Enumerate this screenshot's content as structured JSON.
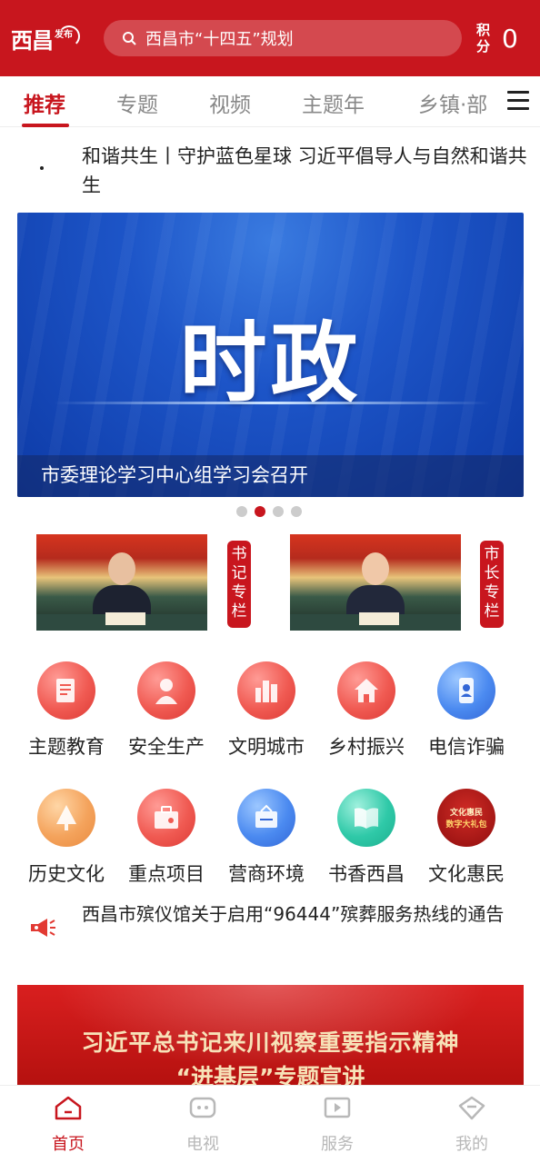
{
  "header": {
    "logo_main": "西昌",
    "logo_sub": "发布",
    "search_placeholder": "西昌市“十四五”规划",
    "points_label": "积分",
    "points_value": "0"
  },
  "tabs": [
    "推荐",
    "专题",
    "视频",
    "主题年",
    "乡镇·部"
  ],
  "active_tab": "推荐",
  "headline": "和谐共生丨守护蓝色星球  习近平倡导人与自然和谐共生",
  "banner": {
    "title": "时政",
    "caption": "市委理论学习中心组学习会召开",
    "slide_count": 4,
    "active_slide": 2
  },
  "leaders": [
    {
      "label": "书记专栏"
    },
    {
      "label": "市长专栏"
    }
  ],
  "shortcuts": [
    {
      "label": "主题教育",
      "icon": "document-icon"
    },
    {
      "label": "安全生产",
      "icon": "worker-icon"
    },
    {
      "label": "文明城市",
      "icon": "city-icon"
    },
    {
      "label": "乡村振兴",
      "icon": "house-icon"
    },
    {
      "label": "电信诈骗",
      "icon": "phone-icon"
    },
    {
      "label": "历史文化",
      "icon": "tree-icon"
    },
    {
      "label": "重点项目",
      "icon": "briefcase-icon"
    },
    {
      "label": "营商环境",
      "icon": "sign-icon"
    },
    {
      "label": "书香西昌",
      "icon": "book-icon"
    },
    {
      "label": "文化惠民",
      "icon": "culture-icon",
      "icon_text": "文化惠民\n数字大礼包"
    }
  ],
  "notice": "西昌市殡仪馆关于启用“96444”殡葬服务热线的通告",
  "promo": {
    "line1": "习近平总书记来川视察重要指示精神",
    "line2": "“进基层”专题宣讲"
  },
  "bottom_nav": [
    {
      "label": "首页",
      "icon": "home-icon",
      "active": true
    },
    {
      "label": "电视",
      "icon": "tv-icon",
      "active": false
    },
    {
      "label": "服务",
      "icon": "play-icon",
      "active": false
    },
    {
      "label": "我的",
      "icon": "profile-icon",
      "active": false
    }
  ],
  "colors": {
    "brand_red": "#c8161e",
    "inactive_gray": "#b8b8b8"
  }
}
